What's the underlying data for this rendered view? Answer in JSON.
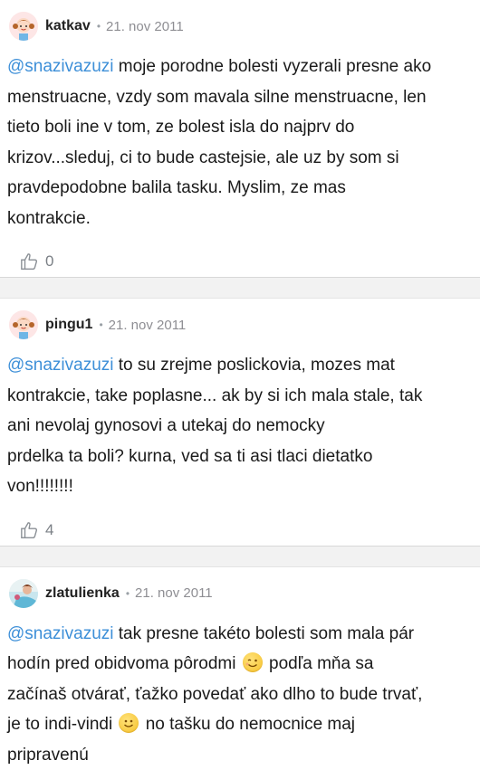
{
  "posts": [
    {
      "username": "katkav",
      "date": "21. nov 2011",
      "mention": "@snazivazuzi",
      "lines": [
        " moje porodne bolesti vyzerali presne ako",
        "menstruacne, vzdy som mavala silne menstruacne, len",
        "tieto boli ine v tom, ze bolest isla do najprv do",
        "krizov...sleduj, ci to bude castejsie, ale uz by som si",
        "pravdepodobne balila tasku. Myslim, ze mas",
        "kontrakcie."
      ],
      "likes": "0",
      "avatar_icon": "girl-avatar-icon"
    },
    {
      "username": "pingu1",
      "date": "21. nov 2011",
      "mention": "@snazivazuzi",
      "lines": [
        " to su zrejme poslickovia, mozes mat",
        "kontrakcie, take poplasne... ak by si ich mala stale, tak",
        "ani nevolaj gynosovi a utekaj do nemocky",
        "prdelka ta boli? kurna, ved sa ti asi tlaci dietatko",
        "von!!!!!!!!"
      ],
      "likes": "4",
      "avatar_icon": "girl-avatar-icon"
    },
    {
      "username": "zlatulienka",
      "date": "21. nov 2011",
      "mention": "@snazivazuzi",
      "line1": " tak presne takéto bolesti som mala pár",
      "line2a": "hodín pred obidvoma pôrodmi ",
      "line2b": " podľa mňa sa",
      "line3": "začínaš otvárať, ťažko povedať ako dlho to bude trvať,",
      "line4a": "je to indi-vindi ",
      "line4b": " no tašku do nemocnice maj",
      "line5": "pripravenú",
      "avatar_icon": "photo-avatar-icon"
    }
  ],
  "separator": "•",
  "colors": {
    "mention": "#3d8fd8",
    "meta": "#8e8e93",
    "divider": "#f2f2f2"
  },
  "icons": {
    "like": "thumbs-up-icon",
    "wink": "wink-emoji-icon",
    "smile": "smile-emoji-icon"
  }
}
